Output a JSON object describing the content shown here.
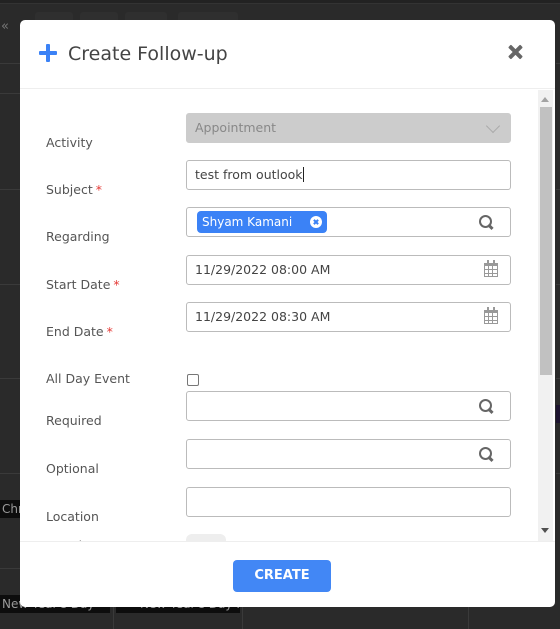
{
  "background": {
    "events": [
      "Christmas Day",
      "New Year's Day",
      "New Year's Day ..."
    ]
  },
  "modal": {
    "title": "Create Follow-up",
    "icon": "plus-icon",
    "close_icon": "close-icon",
    "fields": {
      "activity": {
        "label": "Activity",
        "value": "Appointment",
        "disabled": true
      },
      "subject": {
        "label": "Subject",
        "required_mark": "*",
        "value": "test from outlook"
      },
      "regarding": {
        "label": "Regarding",
        "chips": [
          {
            "label": "Shyam Kamani"
          }
        ]
      },
      "start_date": {
        "label": "Start Date",
        "required_mark": "*",
        "value": "11/29/2022 08:00 AM"
      },
      "end_date": {
        "label": "End Date",
        "required_mark": "*",
        "value": "11/29/2022 08:30 AM"
      },
      "all_day_event": {
        "label": "All Day Event",
        "checked": false
      },
      "required": {
        "label": "Required",
        "value": ""
      },
      "optional": {
        "label": "Optional",
        "value": ""
      },
      "location": {
        "label": "Location",
        "value": ""
      },
      "attachments": {
        "label": "Attachments"
      }
    },
    "footer": {
      "create_label": "CREATE"
    }
  },
  "colors": {
    "accent": "#3b82f6",
    "button": "#4287f5",
    "required": "#e53935",
    "disabled_bg": "#cccccc"
  }
}
